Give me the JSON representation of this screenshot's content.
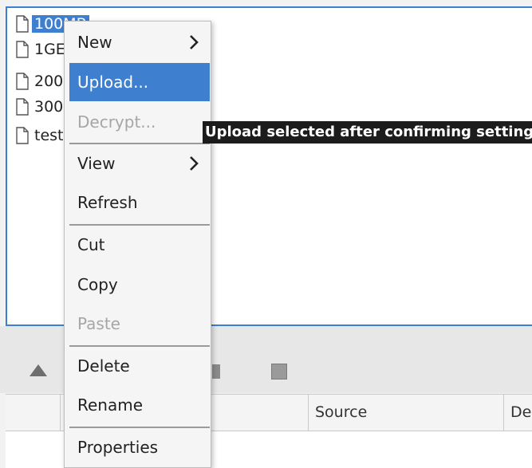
{
  "files": [
    {
      "name": "100MB",
      "selected": true
    },
    {
      "name": "1GE",
      "selected": false
    },
    {
      "name": "200",
      "selected": false
    },
    {
      "name": "300",
      "selected": false
    },
    {
      "name": "test",
      "selected": false
    }
  ],
  "context_menu": {
    "new": "New",
    "upload": "Upload...",
    "decrypt": "Decrypt...",
    "view": "View",
    "refresh": "Refresh",
    "cut": "Cut",
    "copy": "Copy",
    "paste": "Paste",
    "delete": "Delete",
    "rename": "Rename",
    "properties": "Properties"
  },
  "tooltip": "Upload selected after confirming settings",
  "queue": {
    "columns": [
      "Source",
      "De"
    ]
  },
  "icons": {
    "file": "document-icon",
    "submenu": "chevron-right-icon",
    "toolbar": [
      "upload-arrow-icon",
      "pause-icon",
      "stop-icon"
    ]
  },
  "colors": {
    "accent": "#3f7fd0",
    "tooltip_bg": "#1c1c1c",
    "disabled_text": "#a6a6a6"
  }
}
